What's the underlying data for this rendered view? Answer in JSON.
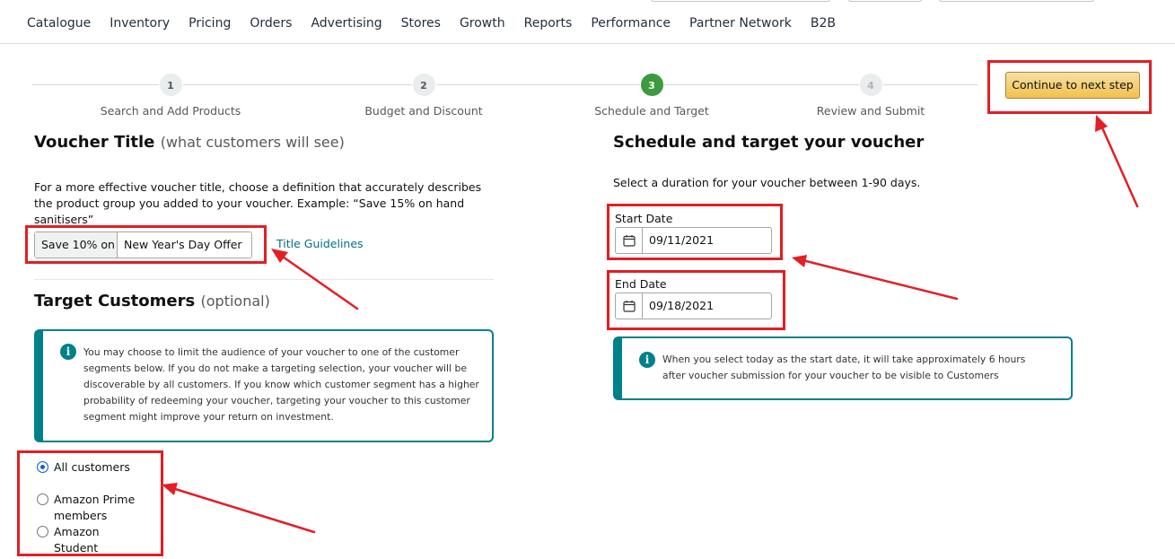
{
  "nav": {
    "items": [
      "Catalogue",
      "Inventory",
      "Pricing",
      "Orders",
      "Advertising",
      "Stores",
      "Growth",
      "Reports",
      "Performance",
      "Partner Network",
      "B2B"
    ]
  },
  "stepper": {
    "steps": [
      {
        "number": "1",
        "label": "Search and Add Products"
      },
      {
        "number": "2",
        "label": "Budget and Discount"
      },
      {
        "number": "3",
        "label": "Schedule and Target"
      },
      {
        "number": "4",
        "label": "Review and Submit"
      }
    ],
    "continue_label": "Continue to next step"
  },
  "voucher_title": {
    "heading": "Voucher Title",
    "heading_sub": "(what customers will see)",
    "description": "For a more effective voucher title, choose a definition that accurately describes the product group you added to your voucher.  Example: “Save 15% on hand sanitisers”",
    "prefix": "Save 10% on",
    "value": "New Year's Day Offer",
    "guidelines_link": "Title Guidelines"
  },
  "target_customers": {
    "heading": "Target Customers",
    "heading_sub": "(optional)",
    "info": "You may choose to limit the audience of your voucher to one of the customer segments below. If you do not make a targeting selection, your voucher will be discoverable by all customers. If you know which customer segment has a higher probability of redeeming your voucher, targeting your voucher to this customer segment might improve your return on investment.",
    "options": [
      {
        "label": "All customers",
        "checked": true
      },
      {
        "label": "Amazon Prime members",
        "checked": false
      },
      {
        "label": "Amazon Student members",
        "checked": false
      }
    ]
  },
  "schedule": {
    "heading": "Schedule and target your voucher",
    "description": "Select a duration for your voucher between 1-90 days.",
    "start_label": "Start Date",
    "start_value": "09/11/2021",
    "end_label": "End Date",
    "end_value": "09/18/2021",
    "info": "When you select today as the start date, it will take approximately 6 hours after voucher submission for your voucher to be visible to Customers"
  },
  "colors": {
    "accent_teal": "#00818a",
    "annotation_red": "#e31e24",
    "active_step": "#3d9a3e",
    "button_yellow": "#f0c14b"
  }
}
